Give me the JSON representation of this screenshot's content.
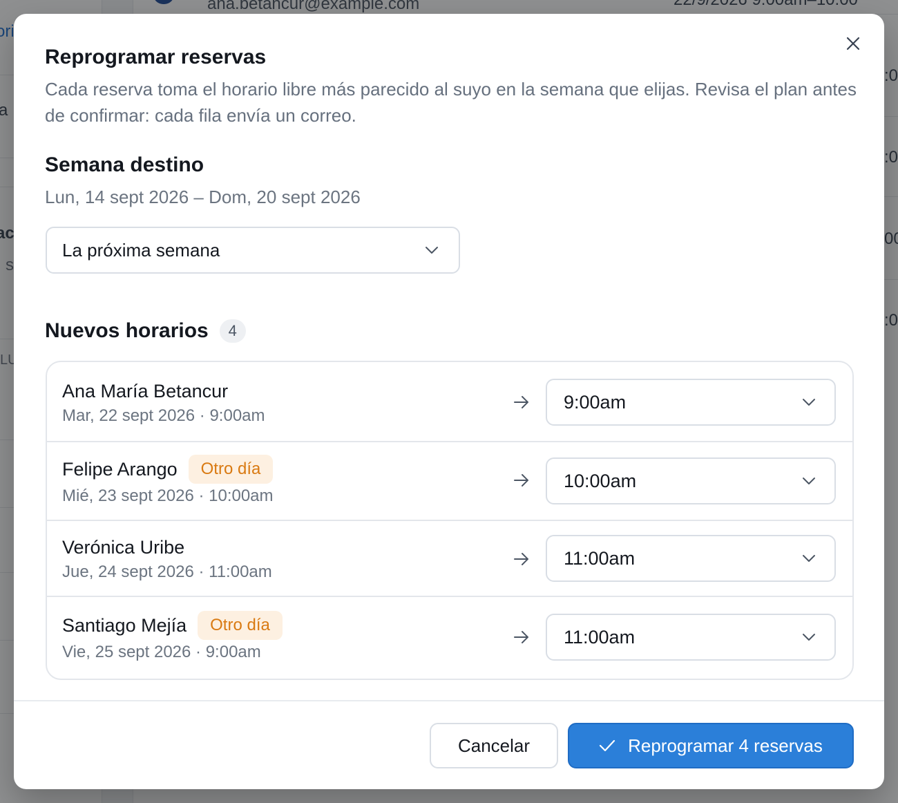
{
  "background": {
    "email": "ana.betancur@example.com",
    "date_fragment": "22/9/2026 9:00am–10:00",
    "sidebar_link_fragment": "ori",
    "fragments": [
      "a",
      "ac",
      "s",
      "LU",
      ":0",
      ":0",
      "00",
      ":0"
    ]
  },
  "modal": {
    "title": "Reprogramar reservas",
    "description": "Cada reserva toma el horario libre más parecido al suyo en la semana que elijas. Revisa el plan antes de confirmar: cada fila envía un correo.",
    "close_icon": "close-icon"
  },
  "target_week": {
    "heading": "Semana destino",
    "range": "Lun, 14 sept 2026 – Dom, 20 sept 2026",
    "selected": "La próxima semana"
  },
  "new_slots": {
    "heading": "Nuevos horarios",
    "count": "4",
    "rows": [
      {
        "name": "Ana María Betancur",
        "badge": "",
        "original": "Mar, 22 sept 2026 · 9:00am",
        "new_time": "9:00am"
      },
      {
        "name": "Felipe Arango",
        "badge": "Otro día",
        "original": "Mié, 23 sept 2026 · 10:00am",
        "new_time": "10:00am"
      },
      {
        "name": "Verónica Uribe",
        "badge": "",
        "original": "Jue, 24 sept 2026 · 11:00am",
        "new_time": "11:00am"
      },
      {
        "name": "Santiago Mejía",
        "badge": "Otro día",
        "original": "Vie, 25 sept 2026 · 9:00am",
        "new_time": "11:00am"
      }
    ]
  },
  "footer": {
    "cancel_label": "Cancelar",
    "confirm_label": "Reprogramar 4 reservas"
  },
  "colors": {
    "primary": "#2b7fd9",
    "badge_bg": "#fdf0e1",
    "badge_text": "#d97a12",
    "muted_text": "#6b7480"
  }
}
